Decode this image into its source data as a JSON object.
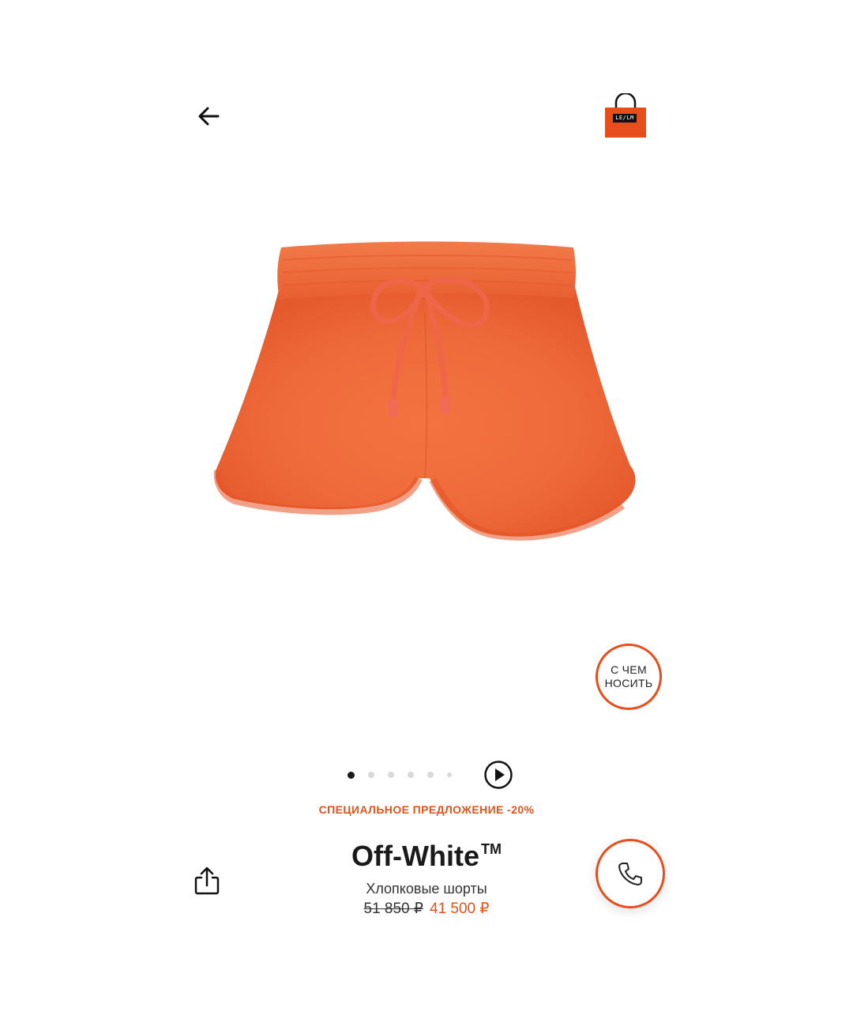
{
  "header": {
    "back_icon": "arrow-left-icon",
    "bag_icon": "shopping-bag-icon",
    "bag_logo_text": "LE/LM",
    "accent_color": "#e84e1b"
  },
  "product": {
    "image_alt_icon": "orange-shorts-image",
    "wear_with_label": "С ЧЕМ НОСИТЬ",
    "carousel": {
      "count": 6,
      "active_index": 0
    },
    "play_icon": "play-circle-icon",
    "promo": "СПЕЦИАЛЬНОЕ ПРЕДЛОЖЕНИЕ -20%",
    "brand": "Off-White",
    "brand_tm": "TM",
    "name": "Хлопковые шорты",
    "old_price": "51 850 ₽",
    "new_price": "41 500 ₽",
    "share_icon": "share-icon",
    "call_icon": "phone-icon"
  }
}
